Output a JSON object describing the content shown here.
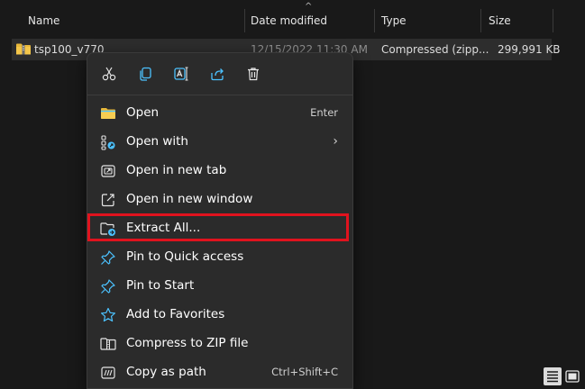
{
  "columns": {
    "name": "Name",
    "date_modified": "Date modified",
    "type": "Type",
    "size": "Size"
  },
  "file": {
    "name": "tsp100_v770",
    "date": "12/15/2022 11:30 AM",
    "type": "Compressed (zipp...",
    "size": "299,991 KB"
  },
  "toolbar": {
    "icons": [
      "cut-icon",
      "copy-icon",
      "rename-icon",
      "share-icon",
      "delete-icon"
    ]
  },
  "menu_items": [
    {
      "label": "Open",
      "shortcut": "Enter",
      "icon": "folder-icon"
    },
    {
      "label": "Open with",
      "shortcut": "",
      "icon": "open-with-icon",
      "submenu": true
    },
    {
      "label": "Open in new tab",
      "shortcut": "",
      "icon": "new-tab-icon"
    },
    {
      "label": "Open in new window",
      "shortcut": "",
      "icon": "new-window-icon"
    },
    {
      "label": "Extract All...",
      "shortcut": "",
      "icon": "extract-icon"
    },
    {
      "label": "Pin to Quick access",
      "shortcut": "",
      "icon": "pin-icon"
    },
    {
      "label": "Pin to Start",
      "shortcut": "",
      "icon": "pin-icon"
    },
    {
      "label": "Add to Favorites",
      "shortcut": "",
      "icon": "star-icon"
    },
    {
      "label": "Compress to ZIP file",
      "shortcut": "",
      "icon": "zip-icon"
    },
    {
      "label": "Copy as path",
      "shortcut": "Ctrl+Shift+C",
      "icon": "copy-path-icon"
    }
  ],
  "submenu_chevron": "›",
  "colors": {
    "background": "#191919",
    "menu": "#2b2b2b",
    "highlight_border": "#e0131e",
    "accent": "#4cc2ff"
  }
}
